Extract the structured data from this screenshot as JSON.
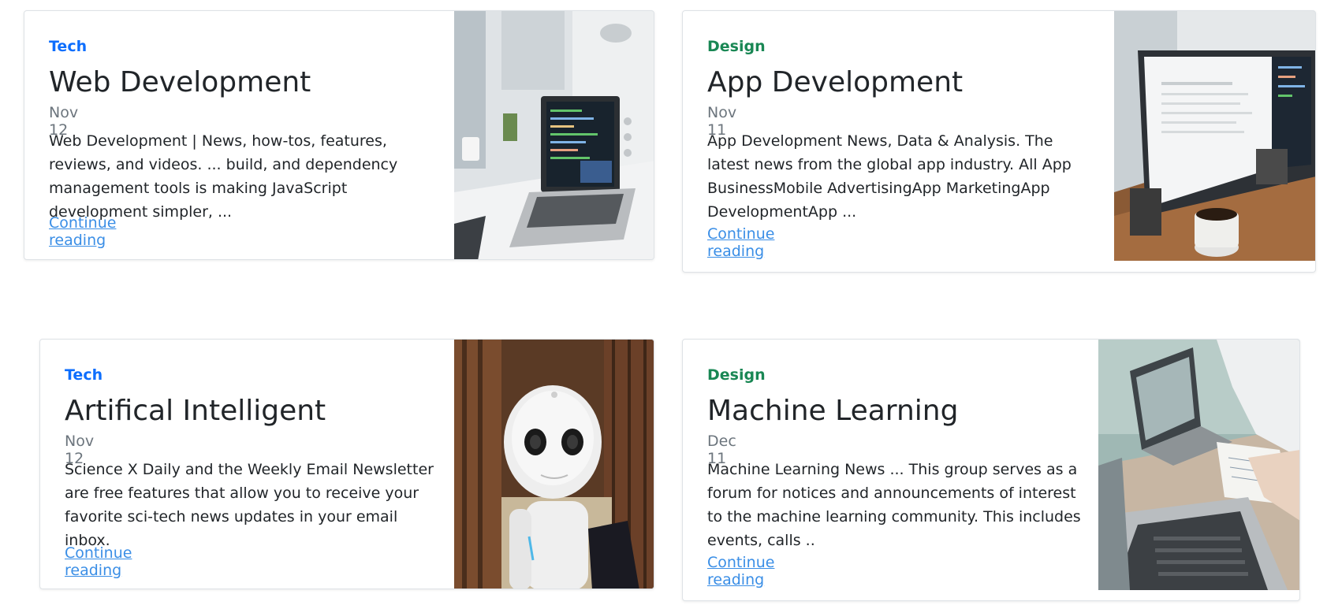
{
  "cards": [
    {
      "category": "Tech",
      "title": "Web Development",
      "date": "Nov 12",
      "excerpt": "Web Development | News, how-tos, features, reviews, and videos. ... build, and dependency management tools is making JavaScript development simpler, ...",
      "link": "Continue reading",
      "image": "laptop-desk-photo"
    },
    {
      "category": "Design",
      "title": "App Development",
      "date": "Nov 11",
      "excerpt": "App Development News, Data & Analysis. The latest news from the global app industry. All App BusinessMobile AdvertisingApp MarketingApp DevelopmentApp ...",
      "link": "Continue reading",
      "image": "monitor-coffee-photo"
    },
    {
      "category": "Tech",
      "title": "Artifical Intelligent",
      "date": "Nov 12",
      "excerpt": "Science X Daily and the Weekly Email Newsletter are free features that allow you to receive your favorite sci-tech news updates in your email inbox.",
      "link": "Continue reading",
      "image": "robot-photo"
    },
    {
      "category": "Design",
      "title": "Machine Learning",
      "date": "Dec 11",
      "excerpt": "Machine Learning News ... This group serves as a forum for notices and announcements of interest to the machine learning community. This includes events, calls ..",
      "link": "Continue reading",
      "image": "laptops-meeting-photo"
    }
  ],
  "colors": {
    "tech": "#0d6efd",
    "design": "#198754",
    "link": "#3a8ee6",
    "muted": "#6c757d"
  }
}
